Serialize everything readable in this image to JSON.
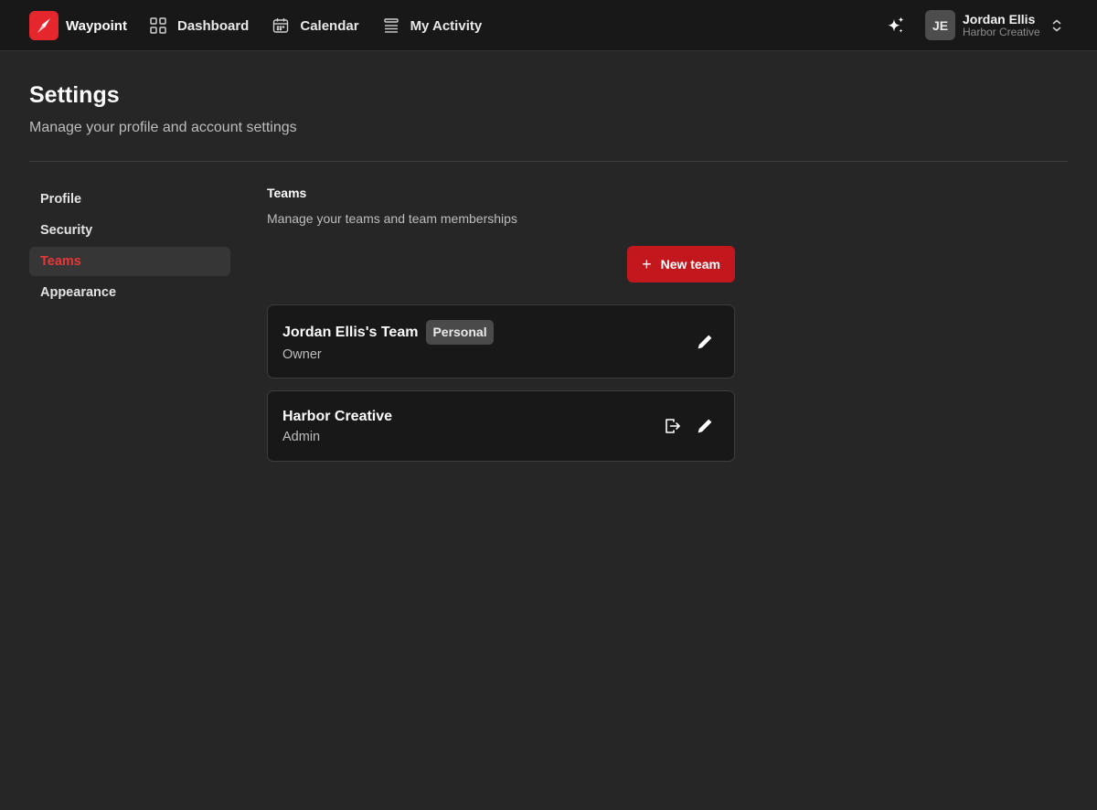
{
  "app": {
    "name": "Waypoint",
    "brand_color": "#e5262d"
  },
  "nav": {
    "items": [
      {
        "label": "Dashboard",
        "icon": "grid-icon"
      },
      {
        "label": "Calendar",
        "icon": "calendar-icon"
      },
      {
        "label": "My Activity",
        "icon": "list-icon"
      }
    ]
  },
  "user": {
    "initials": "JE",
    "name": "Jordan Ellis",
    "team": "Harbor Creative"
  },
  "page": {
    "title": "Settings",
    "subtitle": "Manage your profile and account settings"
  },
  "sidebar": {
    "items": [
      {
        "label": "Profile"
      },
      {
        "label": "Security"
      },
      {
        "label": "Teams",
        "active": true
      },
      {
        "label": "Appearance"
      }
    ]
  },
  "teams_section": {
    "title": "Teams",
    "subtitle": "Manage your teams and team memberships",
    "new_team_label": "New team",
    "accent_color": "#c1171d"
  },
  "teams": [
    {
      "name": "Jordan Ellis's Team",
      "badge": "Personal",
      "role": "Owner"
    },
    {
      "name": "Harbor Creative",
      "role": "Admin"
    }
  ]
}
